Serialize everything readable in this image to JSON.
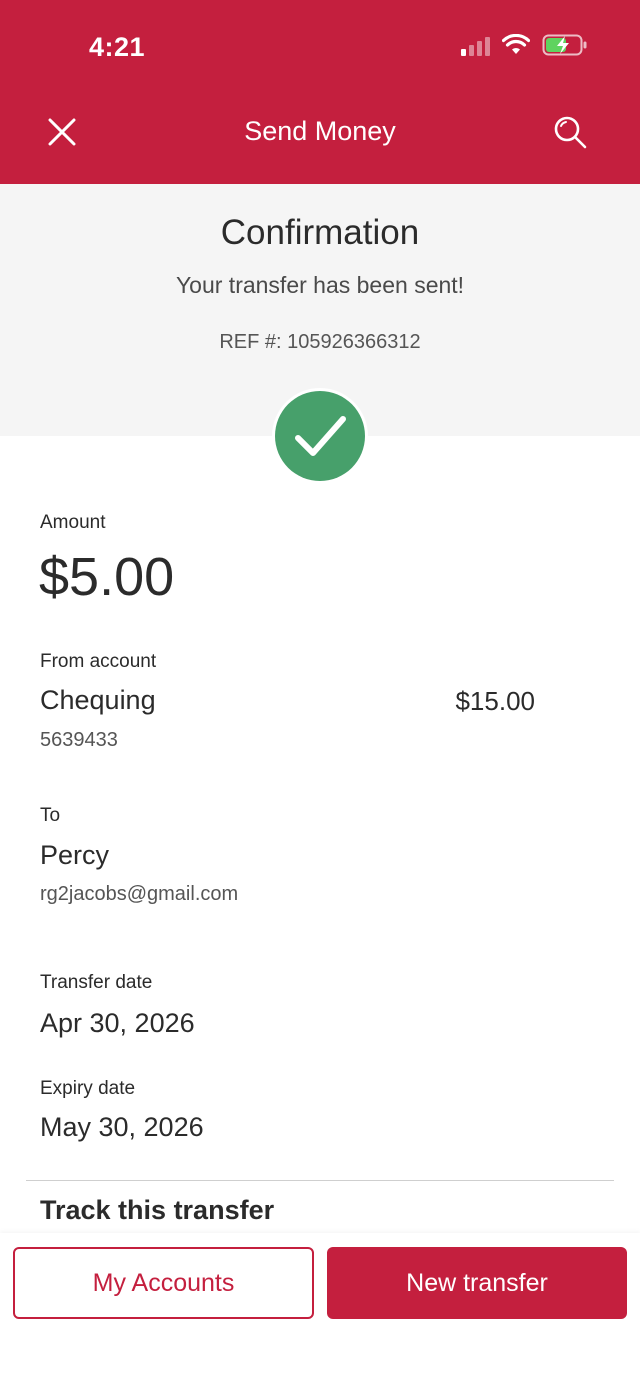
{
  "status_bar": {
    "time": "4:21"
  },
  "header": {
    "title": "Send Money",
    "close_icon": "close-icon",
    "search_icon": "search-icon",
    "brand_color": "#c41f3e"
  },
  "confirmation": {
    "title": "Confirmation",
    "message": "Your transfer has been sent!",
    "reference": "REF #: 105926366312",
    "status_icon": "checkmark-icon",
    "status_color": "#47a06b"
  },
  "details": {
    "amount_label": "Amount",
    "amount": "$5.00",
    "from_label": "From account",
    "from_account_name": "Chequing",
    "from_account_balance": "$15.00",
    "from_account_number": "5639433",
    "to_label": "To",
    "to_name": "Percy",
    "to_email": "rg2jacobs@gmail.com",
    "transfer_date_label": "Transfer date",
    "transfer_date": "Apr 30, 2026",
    "expiry_date_label": "Expiry date",
    "expiry_date": "May 30, 2026",
    "track_label": "Track this transfer"
  },
  "footer": {
    "my_accounts_label": "My Accounts",
    "new_transfer_label": "New transfer"
  }
}
